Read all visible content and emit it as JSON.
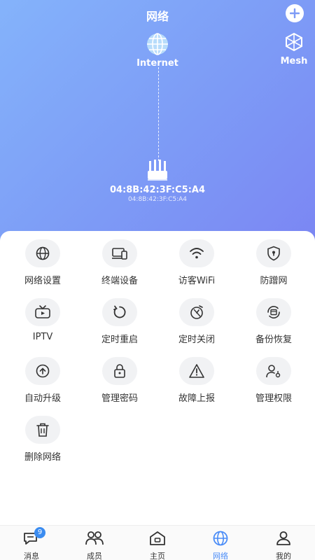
{
  "header": {
    "title": "网络",
    "mesh_label": "Mesh"
  },
  "topology": {
    "internet_label": "Internet",
    "router_mac": "04:8B:42:3F:C5:A4",
    "router_mac_sub": "04:8B:42:3F:C5:A4"
  },
  "features": [
    {
      "label": "网络设置",
      "icon": "globe-icon"
    },
    {
      "label": "终端设备",
      "icon": "devices-icon"
    },
    {
      "label": "访客WiFi",
      "icon": "wifi-icon"
    },
    {
      "label": "防蹭网",
      "icon": "shield-icon"
    },
    {
      "label": "IPTV",
      "icon": "tv-icon"
    },
    {
      "label": "定时重启",
      "icon": "restart-icon"
    },
    {
      "label": "定时关闭",
      "icon": "timer-off-icon"
    },
    {
      "label": "备份恢复",
      "icon": "backup-icon"
    },
    {
      "label": "自动升级",
      "icon": "upgrade-icon"
    },
    {
      "label": "管理密码",
      "icon": "lock-icon"
    },
    {
      "label": "故障上报",
      "icon": "warning-icon"
    },
    {
      "label": "管理权限",
      "icon": "user-key-icon"
    },
    {
      "label": "删除网络",
      "icon": "trash-icon"
    }
  ],
  "tabs": [
    {
      "label": "消息",
      "badge": "9"
    },
    {
      "label": "成员"
    },
    {
      "label": "主页"
    },
    {
      "label": "网络"
    },
    {
      "label": "我的"
    }
  ],
  "colors": {
    "accent": "#4a8cf7",
    "hero_start": "#84b3fb",
    "hero_end": "#7b86f3"
  }
}
